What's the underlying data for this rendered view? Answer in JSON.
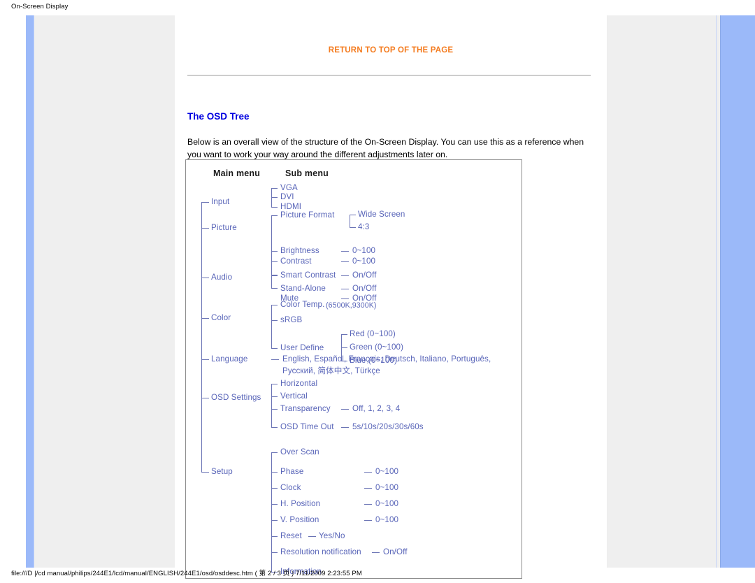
{
  "browser": {
    "print_header": "On-Screen Display",
    "print_footer": "file:///D |/cd manual/philips/244E1/lcd/manual/ENGLISH/244E1/osd/osddesc.htm ( 第 2 / 3 页 ) 7/11/2009 2:23:55 PM"
  },
  "colors": {
    "accent_orange": "#f47c20",
    "heading_blue": "#0000e0",
    "tree_blue": "#5864b8",
    "chrome_blue": "#9bb9f9",
    "panel_gray": "#efefef"
  },
  "content": {
    "return_to_top": "RETURN TO TOP OF THE PAGE",
    "section_title": "The OSD Tree",
    "intro": "Below is an overall view of the structure of the On-Screen Display. You can use this as a reference when you want to work your way around the different adjustments later on."
  },
  "osd_tree": {
    "headers": {
      "main": "Main menu",
      "sub": "Sub menu"
    },
    "menus": [
      {
        "name": "Input",
        "items": [
          {
            "label": "VGA"
          },
          {
            "label": "DVI"
          },
          {
            "label": "HDMI"
          }
        ]
      },
      {
        "name": "Picture",
        "items": [
          {
            "label": "Picture Format",
            "children": [
              "Wide Screen",
              "4:3"
            ]
          },
          {
            "label": "Brightness",
            "value": "0~100"
          },
          {
            "label": "Contrast",
            "value": "0~100"
          },
          {
            "label": "Smart Contrast",
            "value": "On/Off"
          }
        ]
      },
      {
        "name": "Audio",
        "items": [
          {
            "label": "Stand-Alone",
            "value": "On/Off"
          },
          {
            "label": "Mute",
            "value": "On/Off"
          }
        ]
      },
      {
        "name": "Color",
        "items": [
          {
            "label": "Color Temp.",
            "suffix": "(6500K,9300K)"
          },
          {
            "label": "sRGB"
          },
          {
            "label": "User Define",
            "children": [
              "Red (0~100)",
              "Green (0~100)",
              "Blue (0~100)"
            ]
          }
        ]
      },
      {
        "name": "Language",
        "items": [
          {
            "label": "English, Español, Français, Deutsch, Italiano, Português,"
          },
          {
            "label": "Русский, 简体中文, Türkçe"
          }
        ]
      },
      {
        "name": "OSD Settings",
        "items": [
          {
            "label": "Horizontal"
          },
          {
            "label": "Vertical"
          },
          {
            "label": "Transparency",
            "value": "Off, 1, 2, 3, 4"
          },
          {
            "label": "OSD Time Out",
            "value": "5s/10s/20s/30s/60s"
          }
        ]
      },
      {
        "name": "Setup",
        "items": [
          {
            "label": "Over Scan"
          },
          {
            "label": "Phase",
            "value": "0~100"
          },
          {
            "label": "Clock",
            "value": "0~100"
          },
          {
            "label": "H. Position",
            "value": "0~100"
          },
          {
            "label": "V. Position",
            "value": "0~100"
          },
          {
            "label": "Reset",
            "value": "Yes/No"
          },
          {
            "label": "Resolution notification",
            "value": "On/Off"
          },
          {
            "label": "Information"
          }
        ]
      }
    ]
  }
}
